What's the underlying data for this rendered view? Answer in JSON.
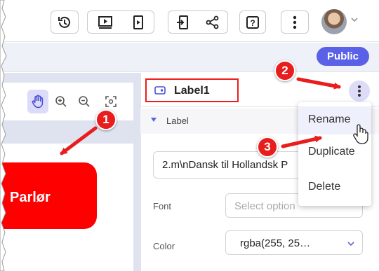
{
  "toolbar": {
    "buttons": [
      "history-icon",
      "preview-icon",
      "device-icon",
      "export-icon",
      "share-icon",
      "help-icon",
      "more-icon"
    ],
    "avatar_alt": "user-avatar"
  },
  "header": {
    "public_badge": "Public"
  },
  "canvas": {
    "tools": [
      "hand-icon",
      "zoom-in-icon",
      "zoom-out-icon",
      "fit-icon"
    ],
    "banner_text": "Parlør"
  },
  "properties": {
    "component_name": "Label1",
    "section": "Label",
    "text_value": "2.m\\nDansk til Hollandsk P",
    "font_label": "Font",
    "font_placeholder": "Select option",
    "color_label": "Color",
    "color_value": "rgba(255, 25…"
  },
  "context_menu": {
    "items": [
      {
        "label": "Rename"
      },
      {
        "label": "Duplicate"
      },
      {
        "label": "Delete"
      }
    ]
  },
  "annotations": {
    "steps": [
      "1",
      "2",
      "3"
    ],
    "color": "#e81d1d"
  },
  "colors": {
    "accent": "#5b61e6",
    "brand_red": "#ff0000",
    "highlight": "#dcdcf9"
  }
}
